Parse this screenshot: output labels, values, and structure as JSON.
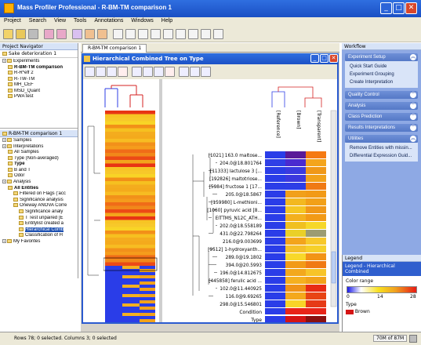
{
  "window": {
    "title": "Mass Profiler Professional - R-BM-TM comparison 1"
  },
  "menu": [
    "Project",
    "Search",
    "View",
    "Tools",
    "Annotations",
    "Windows",
    "Help"
  ],
  "project_navigator": {
    "header": "Project Navigator",
    "experiment_selector": "Sake deterioration 1",
    "items": [
      {
        "label": "Experiments",
        "level": 0,
        "selected": false
      },
      {
        "label": "R-BM-TM comparison",
        "level": 1,
        "selected": false,
        "bold": true
      },
      {
        "label": "R-R*eff 2",
        "level": 1,
        "selected": false
      },
      {
        "label": "R-TW-TM",
        "level": 1,
        "selected": false
      },
      {
        "label": "MH_CEF",
        "level": 1,
        "selected": false
      },
      {
        "label": "MSD_Quant",
        "level": 1,
        "selected": false
      },
      {
        "label": "PWA test",
        "level": 1,
        "selected": false
      }
    ]
  },
  "experiment_navigator": {
    "header": "R-BM-TM comparison 1",
    "items": [
      {
        "label": "Samples",
        "level": 0,
        "selected": false
      },
      {
        "label": "Interpretations",
        "level": 0,
        "selected": false
      },
      {
        "label": "All Samples",
        "level": 1,
        "selected": false
      },
      {
        "label": "Type (Non-averaged)",
        "level": 1,
        "selected": false
      },
      {
        "label": "Type",
        "level": 1,
        "selected": false,
        "bold": true
      },
      {
        "label": "B and T",
        "level": 1,
        "selected": false
      },
      {
        "label": "Odor",
        "level": 1,
        "selected": false
      },
      {
        "label": "Analysis",
        "level": 0,
        "selected": false
      },
      {
        "label": "All Entities",
        "level": 1,
        "selected": false,
        "bold": true
      },
      {
        "label": "Filtered on Flags ('acc",
        "level": 2,
        "selected": false
      },
      {
        "label": "Significance analysis",
        "level": 2,
        "selected": false
      },
      {
        "label": "Oneway ANOVA Corre",
        "level": 2,
        "selected": false
      },
      {
        "label": "Significance analy",
        "level": 3,
        "selected": false
      },
      {
        "label": "T Test unpaired [E",
        "level": 3,
        "selected": false
      },
      {
        "label": "Entitylist created a",
        "level": 3,
        "selected": false
      },
      {
        "label": "Hierarchical Comb",
        "level": 3,
        "selected": true
      },
      {
        "label": "Classification of H",
        "level": 3,
        "selected": false
      },
      {
        "label": "My Favorites",
        "level": 0,
        "selected": false
      }
    ]
  },
  "document_tab": "R-BM-TM comparison 1",
  "inner_window": {
    "title": "Hierarchical Combined Tree on Type"
  },
  "heatmap": {
    "columns": [
      "[Reference]",
      "[Brown]",
      "[Transparent]"
    ],
    "rows": [
      {
        "label": "[1021] 163.0 maltose...",
        "colors": [
          "#2a3de8",
          "#5a1a98",
          "#f57a12"
        ]
      },
      {
        "label": "204.0@18.801764",
        "colors": [
          "#2f3fe6",
          "#4a2ad0",
          "#f4a51c"
        ]
      },
      {
        "label": "[11333] lactulose 3 [...",
        "colors": [
          "#2a3de8",
          "#3a3ae0",
          "#f09818"
        ]
      },
      {
        "label": "[192826] maltotriose...",
        "colors": [
          "#2a3de8",
          "#3c38de",
          "#f2a21a"
        ]
      },
      {
        "label": "[5984] fructose 1 [17...",
        "colors": [
          "#2a3de8",
          "#2d3de6",
          "#f07a14"
        ]
      },
      {
        "label": "205.0@18.5867",
        "colors": [
          "#2a3de8",
          "#f1a01a",
          "#f29a16"
        ]
      },
      {
        "label": "[159980] L-methioni...",
        "colors": [
          "#2a3de8",
          "#f3b820",
          "#f2a018"
        ]
      },
      {
        "label": "[1060] pyruvic acid [8...",
        "colors": [
          "#2a3de8",
          "#f5c624",
          "#f09818"
        ]
      },
      {
        "label": "EITTMS_N12C_ATH...",
        "colors": [
          "#2a3de8",
          "#f3b01e",
          "#f29a16"
        ]
      },
      {
        "label": "202.0@18.558189",
        "colors": [
          "#2a3de8",
          "#f0c020",
          "#f6d72a"
        ]
      },
      {
        "label": "431.0@22.798264",
        "colors": [
          "#2a3de8",
          "#ead028",
          "#9c9c72"
        ]
      },
      {
        "label": "216.0@9.003699",
        "colors": [
          "#2a3de8",
          "#f3a41c",
          "#f7c82a"
        ]
      },
      {
        "label": "[9512] 1-hydroxyanth...",
        "colors": [
          "#2a3de8",
          "#f5c02a",
          "#f6d02a"
        ]
      },
      {
        "label": "289.0@19.1802",
        "colors": [
          "#2a3de8",
          "#f8d82a",
          "#f29416"
        ]
      },
      {
        "label": "394.0@20.5993",
        "colors": [
          "#2a3de8",
          "#f29a16",
          "#f07a14"
        ]
      },
      {
        "label": "196.0@14.812675",
        "colors": [
          "#2a3de8",
          "#f3a81c",
          "#f7c428"
        ]
      },
      {
        "label": "[445858] ferulic acid ...",
        "colors": [
          "#2a3de8",
          "#f5b020",
          "#f2a21a"
        ]
      },
      {
        "label": "102.0@11.440925",
        "colors": [
          "#2a3de8",
          "#f09218",
          "#e82a14"
        ]
      },
      {
        "label": "116.0@9.69265",
        "colors": [
          "#2a3de8",
          "#f4a81c",
          "#e84414"
        ]
      },
      {
        "label": "298.0@15.546801",
        "colors": [
          "#2a3de8",
          "#f8d428",
          "#e63a16"
        ]
      }
    ],
    "annotations": [
      {
        "label": "Condition",
        "colors": [
          "#2a3de8",
          "#e82418",
          "#e82418"
        ]
      },
      {
        "label": "Type",
        "colors": [
          "#2a3de8",
          "#d41414",
          "#8a1010"
        ]
      }
    ]
  },
  "workflow": {
    "header": "Workflow",
    "sections": [
      {
        "title": "Experiment Setup",
        "items": [
          "Quick Start Guide",
          "Experiment Grouping",
          "Create Interpretation"
        ]
      },
      {
        "title": "Quality Control",
        "items": []
      },
      {
        "title": "Analysis",
        "items": []
      },
      {
        "title": "Class Prediction",
        "items": []
      },
      {
        "title": "Results Interpretations",
        "items": []
      },
      {
        "title": "Utilities",
        "items": [
          "Remove Entities with missin...",
          "Differential Expression Guid..."
        ]
      }
    ]
  },
  "legend": {
    "header": "Legend",
    "title": "Legend - Hierarchical Combined",
    "color_range_label": "Color range",
    "ticks": [
      "0",
      "14",
      "28"
    ],
    "type_label": "Type",
    "type_item": "Brown"
  },
  "status": {
    "text": "Rows 78; 0 selected. Columns 3; 0 selected",
    "memory": "70M of 87M"
  }
}
